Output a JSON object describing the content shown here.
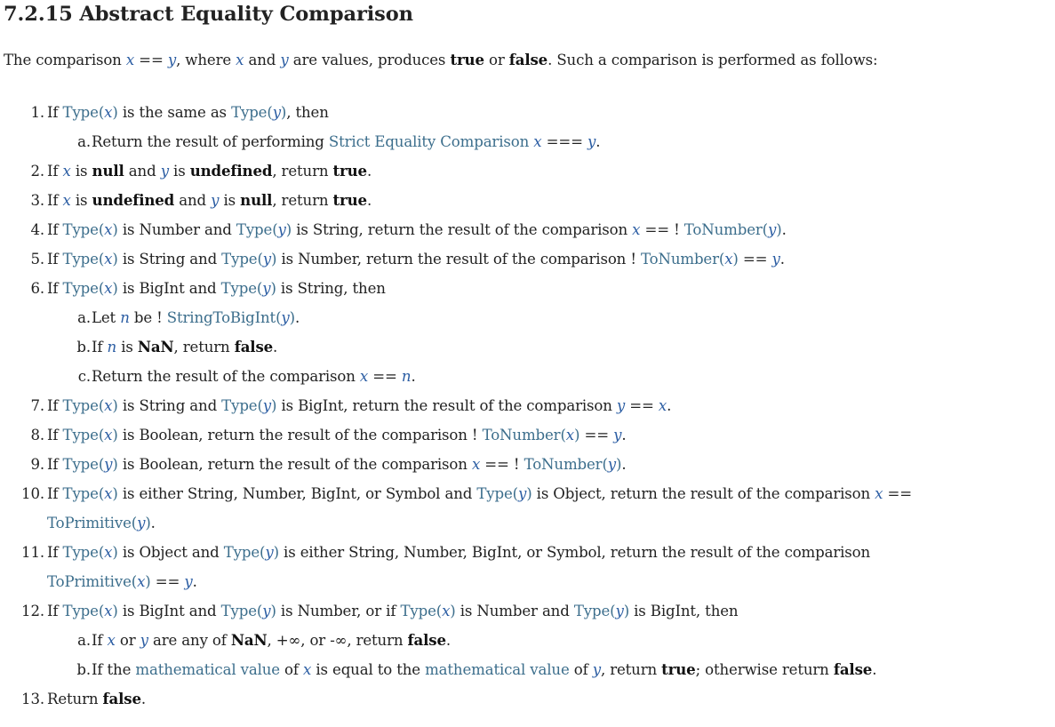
{
  "title": "7.2.15 Abstract Equality Comparison",
  "intro": {
    "t1": "The comparison ",
    "x": "x",
    "op": " == ",
    "y": "y",
    "t2": ", where ",
    "t3": " and ",
    "t4": " are values, produces ",
    "true": "true",
    "t5": " or ",
    "false": "false",
    "t6": ". Such a comparison is performed as follows:"
  },
  "steps": {
    "s1": {
      "num": "1.",
      "a": "If ",
      "type": "Type",
      "lp": "(",
      "x": "x",
      "rp": ")",
      "b": " is the same as ",
      "y": "y",
      "c": ", then",
      "sa": {
        "num": "a.",
        "a": "Return the result of performing ",
        "link": "Strict Equality Comparison",
        "b": " ",
        "x": "x",
        "op": " === ",
        "y": "y",
        "c": "."
      }
    },
    "s2": {
      "num": "2.",
      "a": "If ",
      "x": "x",
      "b": " is ",
      "null": "null",
      "c": " and ",
      "y": "y",
      "d": " is ",
      "undefined": "undefined",
      "e": ", return ",
      "true": "true",
      "f": "."
    },
    "s3": {
      "num": "3.",
      "a": "If ",
      "x": "x",
      "b": " is ",
      "undefined": "undefined",
      "c": " and ",
      "y": "y",
      "d": " is ",
      "null": "null",
      "e": ", return ",
      "true": "true",
      "f": "."
    },
    "s4": {
      "num": "4.",
      "a": "If ",
      "type": "Type",
      "x": "x",
      "b": " is Number and ",
      "y": "y",
      "c": " is String, return the result of the comparison ",
      "op": " == ! ",
      "tonum": "ToNumber",
      "d": "."
    },
    "s5": {
      "num": "5.",
      "a": "If ",
      "type": "Type",
      "x": "x",
      "b": " is String and ",
      "y": "y",
      "c": " is Number, return the result of the comparison ! ",
      "tonum": "ToNumber",
      "op": " == ",
      "d": "."
    },
    "s6": {
      "num": "6.",
      "a": "If ",
      "type": "Type",
      "x": "x",
      "b": " is BigInt and ",
      "y": "y",
      "c": " is String, then",
      "sa": {
        "num": "a.",
        "a": "Let ",
        "n": "n",
        "b": " be ! ",
        "fn": "StringToBigInt",
        "y": "y",
        "c": "."
      },
      "sb": {
        "num": "b.",
        "a": "If ",
        "n": "n",
        "b": " is ",
        "nan": "NaN",
        "c": ", return ",
        "false": "false",
        "d": "."
      },
      "sc": {
        "num": "c.",
        "a": "Return the result of the comparison ",
        "x": "x",
        "op": " == ",
        "n": "n",
        "b": "."
      }
    },
    "s7": {
      "num": "7.",
      "a": "If ",
      "type": "Type",
      "x": "x",
      "b": " is String and ",
      "y": "y",
      "c": " is BigInt, return the result of the comparison ",
      "op": " == ",
      "d": "."
    },
    "s8": {
      "num": "8.",
      "a": "If ",
      "type": "Type",
      "x": "x",
      "b": " is Boolean, return the result of the comparison ! ",
      "tonum": "ToNumber",
      "op": " == ",
      "y": "y",
      "d": "."
    },
    "s9": {
      "num": "9.",
      "a": "If ",
      "type": "Type",
      "y": "y",
      "b": " is Boolean, return the result of the comparison ",
      "x": "x",
      "op": " == ! ",
      "tonum": "ToNumber",
      "d": "."
    },
    "s10": {
      "num": "10.",
      "a": "If ",
      "type": "Type",
      "x": "x",
      "b": " is either String, Number, BigInt, or Symbol and ",
      "y": "y",
      "c": " is Object, return the result of the comparison ",
      "op": " ==",
      "toprim": "ToPrimitive",
      "d": "."
    },
    "s11": {
      "num": "11.",
      "a": "If ",
      "type": "Type",
      "x": "x",
      "b": " is Object and ",
      "y": "y",
      "c": " is either String, Number, BigInt, or Symbol, return the result of the comparison",
      "toprim": "ToPrimitive",
      "op": " == ",
      "d": "."
    },
    "s12": {
      "num": "12.",
      "a": "If ",
      "type": "Type",
      "x": "x",
      "b": " is BigInt and ",
      "y": "y",
      "c": " is Number, or if ",
      "d": " is Number and ",
      "e": " is BigInt, then",
      "sa": {
        "num": "a.",
        "a": "If ",
        "x": "x",
        "b": " or ",
        "y": "y",
        "c": " are any of ",
        "nan": "NaN",
        "d": ", +∞, or -∞, return ",
        "false": "false",
        "e": "."
      },
      "sb": {
        "num": "b.",
        "a": "If the ",
        "mv": "mathematical value",
        "b": " of ",
        "x": "x",
        "c": " is equal to the ",
        "d": " of ",
        "y": "y",
        "e": ", return ",
        "true": "true",
        "f": "; otherwise return ",
        "false": "false",
        "g": "."
      }
    },
    "s13": {
      "num": "13.",
      "a": "Return ",
      "false": "false",
      "b": "."
    }
  },
  "colors": {
    "variable": "#2b5da3",
    "link": "#3c6e8c",
    "text": "#222222"
  }
}
